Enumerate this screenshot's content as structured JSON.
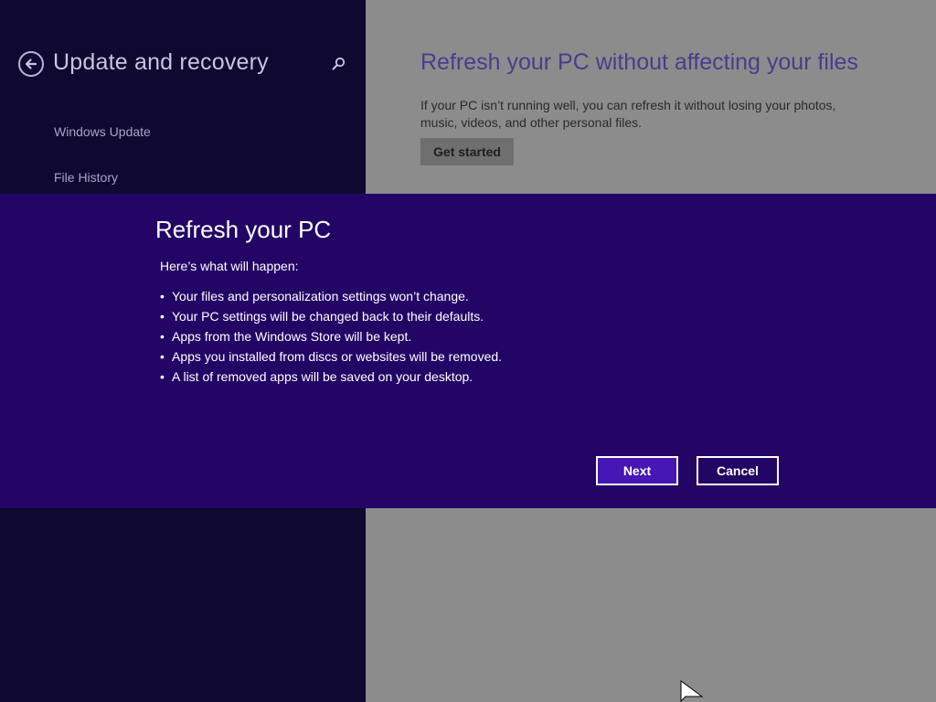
{
  "settings_pane": {
    "title": "Update and recovery",
    "nav_items": [
      {
        "label": "Windows Update"
      },
      {
        "label": "File History"
      }
    ]
  },
  "content": {
    "heading": "Refresh your PC without affecting your files",
    "description": "If your PC isn’t running well, you can refresh it without losing your photos, music, videos, and other personal files.",
    "get_started_label": "Get started"
  },
  "dialog": {
    "title": "Refresh your PC",
    "intro": "Here’s what will happen:",
    "bullet_char": "•",
    "items": [
      {
        "text": "Your files and personalization settings won’t change."
      },
      {
        "text": "Your PC settings will be changed back to their defaults."
      },
      {
        "text": "Apps from the Windows Store will be kept."
      },
      {
        "text": "Apps you installed from discs or websites will be removed."
      },
      {
        "text": "A list of removed apps will be saved on your desktop."
      }
    ],
    "next_label": "Next",
    "cancel_label": "Cancel"
  },
  "icons": {
    "back": "back-arrow-icon",
    "search": "search-icon",
    "cursor": "mouse-pointer-icon"
  },
  "colors": {
    "accent_dialog": "#230566",
    "accent_button": "#4617b4",
    "settings_bg": "#0f0830",
    "content_bg": "#8c8c8c",
    "heading": "#4a3c8c"
  }
}
